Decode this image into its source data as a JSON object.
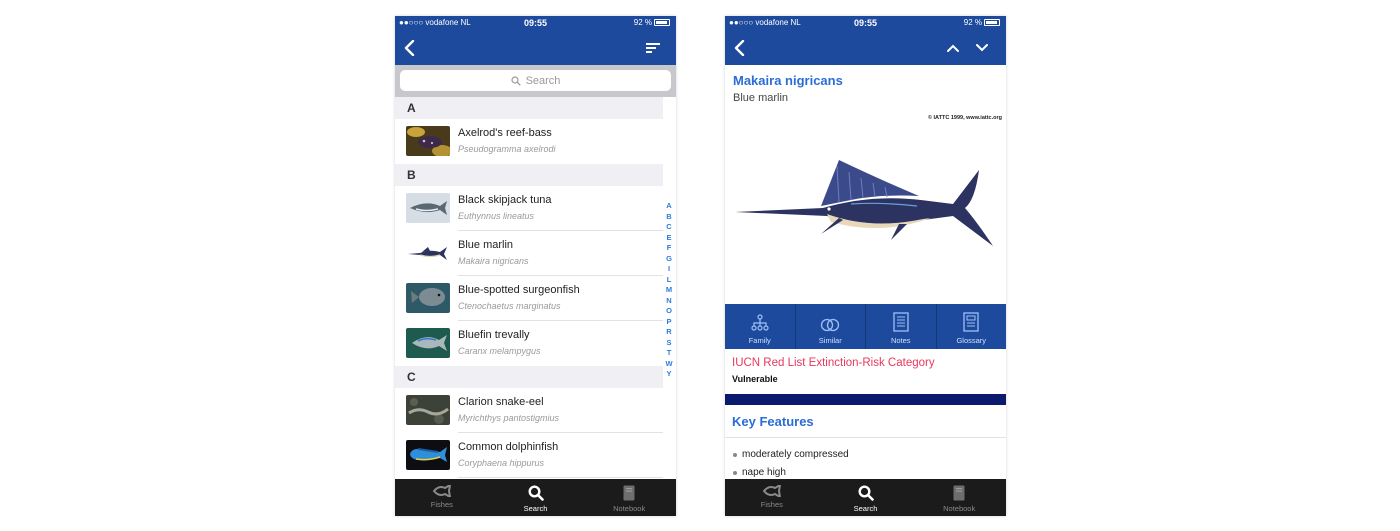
{
  "status": {
    "carrier": "●●○○○ vodafone NL",
    "time": "09:55",
    "battery": "92 %"
  },
  "search": {
    "placeholder": "Search"
  },
  "list": {
    "sections": [
      {
        "letter": "A",
        "rows": [
          {
            "name": "Axelrod's reef-bass",
            "scientific": "Pseudogramma axelrodi"
          }
        ]
      },
      {
        "letter": "B",
        "rows": [
          {
            "name": "Black skipjack tuna",
            "scientific": "Euthynnus lineatus"
          },
          {
            "name": "Blue marlin",
            "scientific": "Makaira nigricans"
          },
          {
            "name": "Blue-spotted surgeonfish",
            "scientific": "Ctenochaetus marginatus"
          },
          {
            "name": "Bluefin trevally",
            "scientific": "Caranx melampygus"
          }
        ]
      },
      {
        "letter": "C",
        "rows": [
          {
            "name": "Clarion snake-eel",
            "scientific": "Myrichthys pantostigmius"
          },
          {
            "name": "Common dolphinfish",
            "scientific": "Coryphaena hippurus"
          }
        ]
      }
    ],
    "index": [
      "A",
      "B",
      "C",
      "E",
      "F",
      "G",
      "I",
      "L",
      "M",
      "N",
      "O",
      "P",
      "R",
      "S",
      "T",
      "W",
      "Y"
    ]
  },
  "tabs": [
    {
      "label": "Fishes",
      "icon": "fish-icon"
    },
    {
      "label": "Search",
      "icon": "search-icon"
    },
    {
      "label": "Notebook",
      "icon": "notebook-icon"
    }
  ],
  "detail": {
    "scientific_name": "Makaira nigricans",
    "common_name": "Blue marlin",
    "copyright": "© IATTC 1999, www.iattc.org",
    "actions": [
      {
        "label": "Family",
        "icon": "family-tree-icon"
      },
      {
        "label": "Similar",
        "icon": "similar-icon"
      },
      {
        "label": "Notes",
        "icon": "notes-icon"
      },
      {
        "label": "Glossary",
        "icon": "glossary-icon"
      }
    ],
    "iucn_title": "IUCN Red List Extinction-Risk Category",
    "iucn_value": "Vulnerable",
    "key_features_title": "Key Features",
    "key_features": [
      "moderately compressed",
      "nape high"
    ]
  },
  "colors": {
    "nav_blue": "#1d4a9c",
    "link_blue": "#2a6dd6",
    "iucn_red": "#e8375b",
    "tabbar": "#1b1b1b"
  }
}
